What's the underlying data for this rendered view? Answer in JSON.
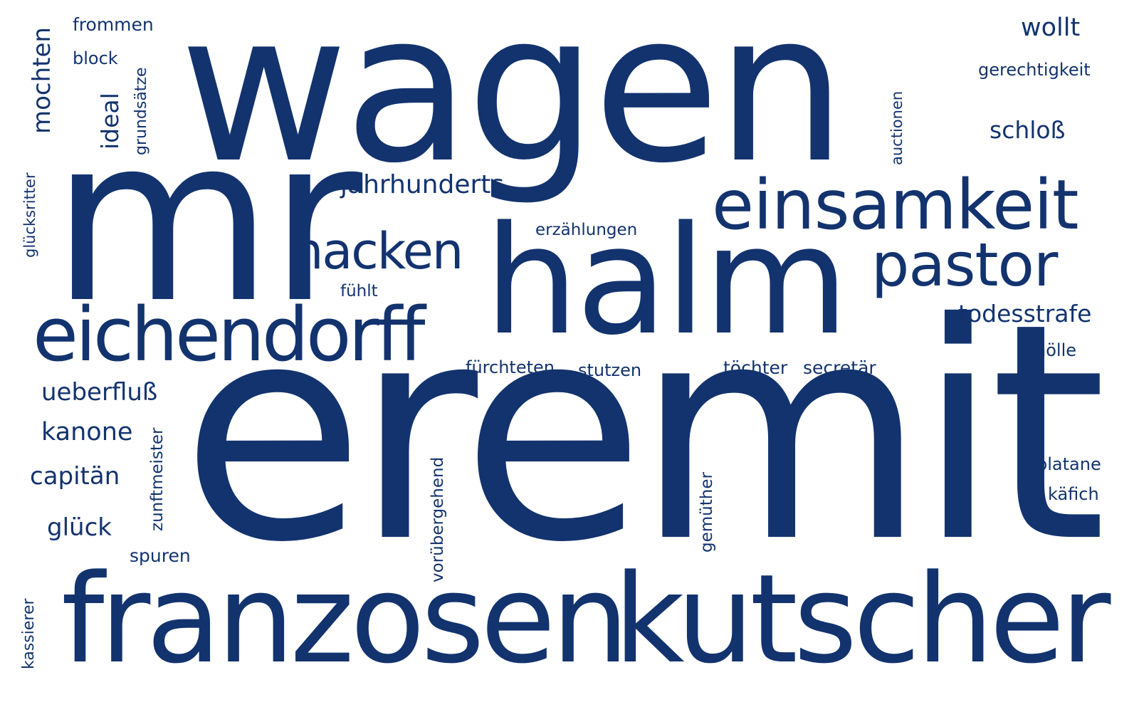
{
  "word_color": "#13336e",
  "background": "#ffffff",
  "words": [
    {
      "id": "wagen",
      "text": "wagen",
      "orientation": "horizontal"
    },
    {
      "id": "mr",
      "text": "mr",
      "orientation": "horizontal"
    },
    {
      "id": "eremit",
      "text": "eremit",
      "orientation": "horizontal"
    },
    {
      "id": "halm",
      "text": "halm",
      "orientation": "horizontal"
    },
    {
      "id": "franzosen",
      "text": "franzosen",
      "orientation": "horizontal"
    },
    {
      "id": "kutscher",
      "text": "kutscher",
      "orientation": "horizontal"
    },
    {
      "id": "einsamkeit",
      "text": "einsamkeit",
      "orientation": "horizontal"
    },
    {
      "id": "eichendorff",
      "text": "eichendorff",
      "orientation": "horizontal"
    },
    {
      "id": "pastor",
      "text": "pastor",
      "orientation": "horizontal"
    },
    {
      "id": "hacken",
      "text": "hacken",
      "orientation": "horizontal"
    },
    {
      "id": "jahrhunderts",
      "text": "jahrhunderts",
      "orientation": "horizontal"
    },
    {
      "id": "todesstrafe",
      "text": "todesstrafe",
      "orientation": "horizontal"
    },
    {
      "id": "schloss",
      "text": "schloß",
      "orientation": "horizontal"
    },
    {
      "id": "wollt",
      "text": "wollt",
      "orientation": "horizontal"
    },
    {
      "id": "gerechtigkeit",
      "text": "gerechtigkeit",
      "orientation": "horizontal"
    },
    {
      "id": "frommen",
      "text": "frommen",
      "orientation": "horizontal"
    },
    {
      "id": "block",
      "text": "block",
      "orientation": "horizontal"
    },
    {
      "id": "ueberfluss",
      "text": "ueberfluß",
      "orientation": "horizontal"
    },
    {
      "id": "kanone",
      "text": "kanone",
      "orientation": "horizontal"
    },
    {
      "id": "capitaen",
      "text": "capitän",
      "orientation": "horizontal"
    },
    {
      "id": "glueck",
      "text": "glück",
      "orientation": "horizontal"
    },
    {
      "id": "spuren",
      "text": "spuren",
      "orientation": "horizontal"
    },
    {
      "id": "erzaehlungen",
      "text": "erzählungen",
      "orientation": "horizontal"
    },
    {
      "id": "fuehlt",
      "text": "fühlt",
      "orientation": "horizontal"
    },
    {
      "id": "fuerchteten",
      "text": "fürchteten",
      "orientation": "horizontal"
    },
    {
      "id": "stutzen",
      "text": "stutzen",
      "orientation": "horizontal"
    },
    {
      "id": "toechter",
      "text": "töchter",
      "orientation": "horizontal"
    },
    {
      "id": "secretaer",
      "text": "secretär",
      "orientation": "horizontal"
    },
    {
      "id": "hoelle",
      "text": "hölle",
      "orientation": "horizontal"
    },
    {
      "id": "platane",
      "text": "platane",
      "orientation": "horizontal"
    },
    {
      "id": "kaefich",
      "text": "käfich",
      "orientation": "horizontal"
    },
    {
      "id": "mochten",
      "text": "mochten",
      "orientation": "vertical"
    },
    {
      "id": "ideal",
      "text": "ideal",
      "orientation": "vertical"
    },
    {
      "id": "grundsaetze",
      "text": "grundsätze",
      "orientation": "vertical"
    },
    {
      "id": "gluecksritter",
      "text": "glücksritter",
      "orientation": "vertical"
    },
    {
      "id": "auctionen",
      "text": "auctionen",
      "orientation": "vertical"
    },
    {
      "id": "zunftmeister",
      "text": "zunftmeister",
      "orientation": "vertical"
    },
    {
      "id": "voruebergehend",
      "text": "vorübergehend",
      "orientation": "vertical"
    },
    {
      "id": "gemuether",
      "text": "gemüther",
      "orientation": "vertical"
    },
    {
      "id": "kassierer",
      "text": "kassierer",
      "orientation": "vertical"
    }
  ]
}
